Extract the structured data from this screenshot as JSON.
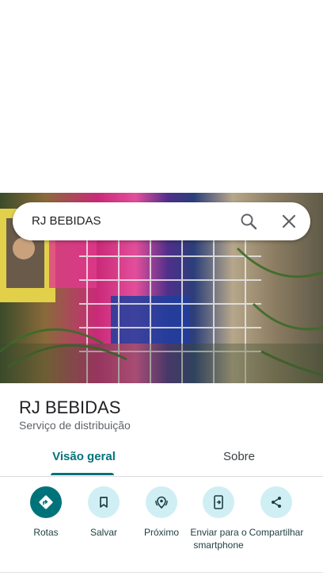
{
  "search": {
    "query": "RJ BEBIDAS"
  },
  "place": {
    "name": "RJ BEBIDAS",
    "category": "Serviço de distribuição"
  },
  "tabs": [
    {
      "label": "Visão geral",
      "selected": true
    },
    {
      "label": "Sobre",
      "selected": false
    }
  ],
  "actions": [
    {
      "label": "Rotas",
      "icon": "directions-icon"
    },
    {
      "label": "Salvar",
      "icon": "bookmark-icon"
    },
    {
      "label": "Próximo",
      "icon": "nearby-icon"
    },
    {
      "label": "Enviar para o smartphone",
      "icon": "send-to-phone-icon"
    },
    {
      "label": "Compartilhar",
      "icon": "share-icon"
    }
  ],
  "colors": {
    "accent": "#00737a",
    "action_bg": "#cfeff5"
  }
}
